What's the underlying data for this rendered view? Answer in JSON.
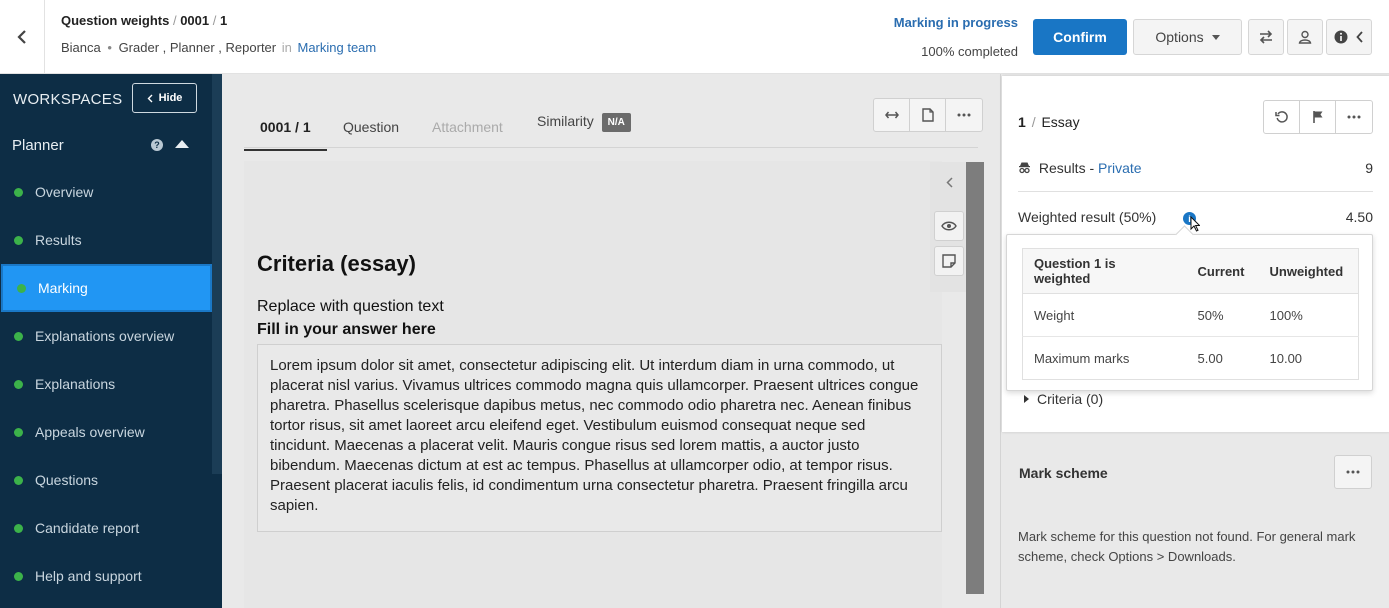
{
  "header": {
    "breadcrumb": [
      "Question weights",
      "0001",
      "1"
    ],
    "user": "Bianca",
    "roles": [
      "Grader",
      "Planner",
      "Reporter"
    ],
    "in_label": "in",
    "team_link": "Marking team",
    "status": "Marking in progress",
    "completed": "100% completed",
    "confirm_label": "Confirm",
    "options_label": "Options"
  },
  "sidebar": {
    "title": "WORKSPACES",
    "hide_label": "Hide",
    "section": "Planner",
    "items": [
      {
        "label": "Overview"
      },
      {
        "label": "Results"
      },
      {
        "label": "Marking",
        "active": true
      },
      {
        "label": "Explanations overview"
      },
      {
        "label": "Explanations"
      },
      {
        "label": "Appeals overview"
      },
      {
        "label": "Questions"
      },
      {
        "label": "Candidate report"
      },
      {
        "label": "Help and support"
      }
    ]
  },
  "tabs": {
    "t1": "0001 / 1",
    "t2": "Question",
    "t3": "Attachment",
    "t4": "Similarity",
    "badge": "N/A"
  },
  "question": {
    "title": "Criteria (essay)",
    "text": "Replace with question text",
    "answer_label": "Fill in your answer here",
    "answer": "Lorem ipsum dolor sit amet, consectetur adipiscing elit. Ut interdum diam in urna commodo, ut placerat nisl varius. Vivamus ultrices commodo magna quis ullamcorper. Praesent ultrices congue pharetra. Phasellus scelerisque dapibus metus, nec commodo odio pharetra nec. Aenean finibus tortor risus, sit amet laoreet arcu eleifend eget. Vestibulum euismod consequat neque sed tincidunt. Maecenas a placerat velit. Mauris congue risus sed lorem mattis, a auctor justo bibendum. Maecenas dictum at est ac tempus. Phasellus at ullamcorper odio, at tempor risus. Praesent placerat iaculis felis, id condimentum urna consectetur pharetra. Praesent fringilla arcu sapien."
  },
  "panel": {
    "number": "1",
    "type": "Essay",
    "results_label": "Results -",
    "results_privacy": "Private",
    "results_value": "9",
    "weighted_label": "Weighted result (50%)",
    "weighted_value": "4.50",
    "criteria_label": "Criteria (0)"
  },
  "popover": {
    "headers": [
      "Question 1 is weighted",
      "Current",
      "Unweighted"
    ],
    "rows": [
      [
        "Weight",
        "50%",
        "100%"
      ],
      [
        "Maximum marks",
        "5.00",
        "10.00"
      ]
    ]
  },
  "mark_scheme": {
    "title": "Mark scheme",
    "text": "Mark scheme for this question not found. For general mark scheme, check Options > Downloads."
  },
  "colors": {
    "accent": "#1976c5",
    "sidebar_bg": "#0d2d45",
    "active_item": "#2196f3",
    "status_dot": "#3cb24a"
  }
}
